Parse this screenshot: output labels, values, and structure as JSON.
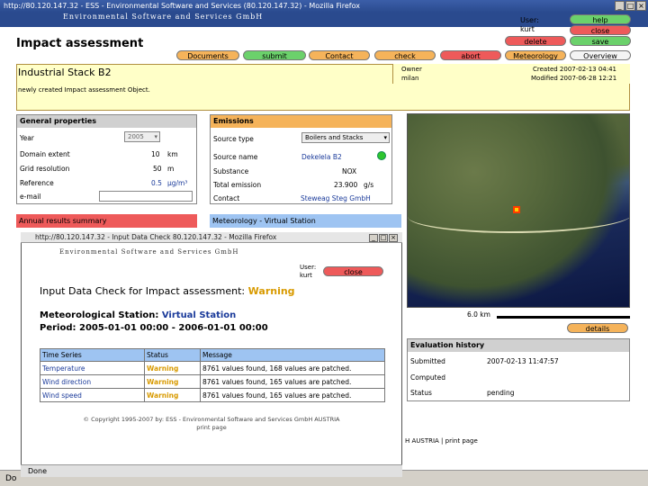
{
  "window": {
    "title": "http://80.120.147.32 - ESS - Environmental Software and Services (80.120.147.32) - Mozilla Firefox",
    "status": "Do"
  },
  "banner": "Environmental Software and Services GmbH",
  "user": {
    "label": "User:",
    "name": "kurt"
  },
  "top_buttons": {
    "help": "help",
    "close": "close",
    "delete": "delete",
    "save": "save"
  },
  "page_title": "Impact assessment",
  "toolbar": {
    "documents": "Documents",
    "submit": "submit",
    "contact": "Contact",
    "check": "check",
    "abort": "abort",
    "meteorology": "Meteorology",
    "overview": "Overview"
  },
  "header": {
    "title": "Industrial Stack B2",
    "description": "newly created Impact assessment Object.",
    "owner_label": "Owner",
    "owner": "milan",
    "created": "Created 2007-02-13 04:41",
    "modified": "Modified 2007-06-28 12:21"
  },
  "general": {
    "heading": "General properties",
    "year_label": "Year",
    "year_value": "2005",
    "extent_label": "Domain extent",
    "extent_value": "10",
    "extent_unit": "km",
    "grid_label": "Grid resolution",
    "grid_value": "50",
    "grid_unit": "m",
    "reference_label": "Reference",
    "reference_value": "0.5",
    "reference_unit": "µg/m³",
    "email_label": "e-mail"
  },
  "emissions": {
    "heading": "Emissions",
    "source_type_label": "Source type",
    "source_type_value": "Boilers and Stacks",
    "source_name_label": "Source name",
    "source_name_value": "Dekelela B2",
    "substance_label": "Substance",
    "substance_value": "NOX",
    "total_label": "Total emission",
    "total_value": "23.900",
    "total_unit": "g/s",
    "contact_label": "Contact",
    "contact_value": "Steweag Steg GmbH"
  },
  "annual_heading": "Annual results summary",
  "meteo_heading": "Meteorology - Virtual Station",
  "map": {
    "scale": "6.0 km",
    "details": "details"
  },
  "evaluation": {
    "heading": "Evaluation history",
    "submitted_label": "Submitted",
    "submitted_value": "2007-02-13 11:47:57",
    "computed_label": "Computed",
    "status_label": "Status",
    "status_value": "pending"
  },
  "footer_behind": "H AUSTRIA | print page",
  "popup": {
    "title": "http://80.120.147.32 - Input Data Check 80.120.147.32 - Mozilla Firefox",
    "banner": "Environmental Software and Services GmbH",
    "user_label": "User:",
    "user_name": "kurt",
    "close": "close",
    "heading": "Input Data Check for Impact assessment:",
    "heading_status": "Warning",
    "station_label": "Meteorological Station:",
    "station_value": "Virtual Station",
    "period": "Period: 2005-01-01 00:00 - 2006-01-01 00:00",
    "columns": [
      "Time Series",
      "Status",
      "Message"
    ],
    "rows": [
      {
        "series": "Temperature",
        "status": "Warning",
        "message": "8761 values found, 168 values are patched."
      },
      {
        "series": "Wind direction",
        "status": "Warning",
        "message": "8761 values found, 165 values are patched."
      },
      {
        "series": "Wind speed",
        "status": "Warning",
        "message": "8761 values found, 165 values are patched."
      }
    ],
    "copyright": "© Copyright 1995-2007 by: ESS - Environmental Software and Services GmbH AUSTRIA",
    "print": "print page",
    "status": "Done"
  }
}
